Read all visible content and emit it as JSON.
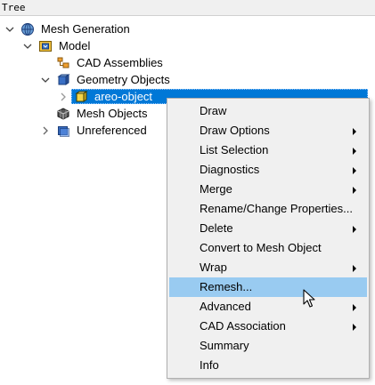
{
  "header": {
    "title": "Tree"
  },
  "tree": {
    "root": {
      "label": "Mesh Generation"
    },
    "model": {
      "label": "Model"
    },
    "cad_assemblies": {
      "label": "CAD Assemblies"
    },
    "geometry_objects": {
      "label": "Geometry Objects"
    },
    "areo_object": {
      "label": "areo-object"
    },
    "mesh_objects": {
      "label": "Mesh Objects"
    },
    "unreferenced": {
      "label": "Unreferenced"
    }
  },
  "context_menu": {
    "items": [
      {
        "label": "Draw",
        "submenu": false
      },
      {
        "label": "Draw Options",
        "submenu": true
      },
      {
        "label": "List Selection",
        "submenu": true
      },
      {
        "label": "Diagnostics",
        "submenu": true
      },
      {
        "label": "Merge",
        "submenu": true
      },
      {
        "label": "Rename/Change Properties...",
        "submenu": false
      },
      {
        "label": "Delete",
        "submenu": true
      },
      {
        "label": "Convert to Mesh Object",
        "submenu": false
      },
      {
        "label": "Wrap",
        "submenu": true
      },
      {
        "label": "Remesh...",
        "submenu": false,
        "highlighted": true
      },
      {
        "label": "Advanced",
        "submenu": true
      },
      {
        "label": "CAD Association",
        "submenu": true
      },
      {
        "label": "Summary",
        "submenu": false
      },
      {
        "label": "Info",
        "submenu": false
      }
    ]
  },
  "colors": {
    "selection": "#0078d7",
    "menu_highlight": "#99cbf1",
    "menu_bg": "#f0f0f0"
  }
}
